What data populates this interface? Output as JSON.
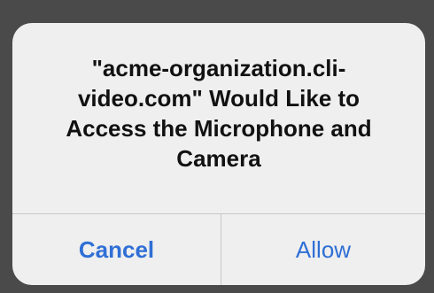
{
  "dialog": {
    "message": "\"acme-organization.cli-video.com\" Would Like to Access the Microphone and Camera",
    "cancel_label": "Cancel",
    "allow_label": "Allow"
  },
  "colors": {
    "backdrop": "#4a4a4a",
    "dialog_background": "#efefef",
    "button_text": "#2f6fd6",
    "divider": "#c8c8c8"
  }
}
